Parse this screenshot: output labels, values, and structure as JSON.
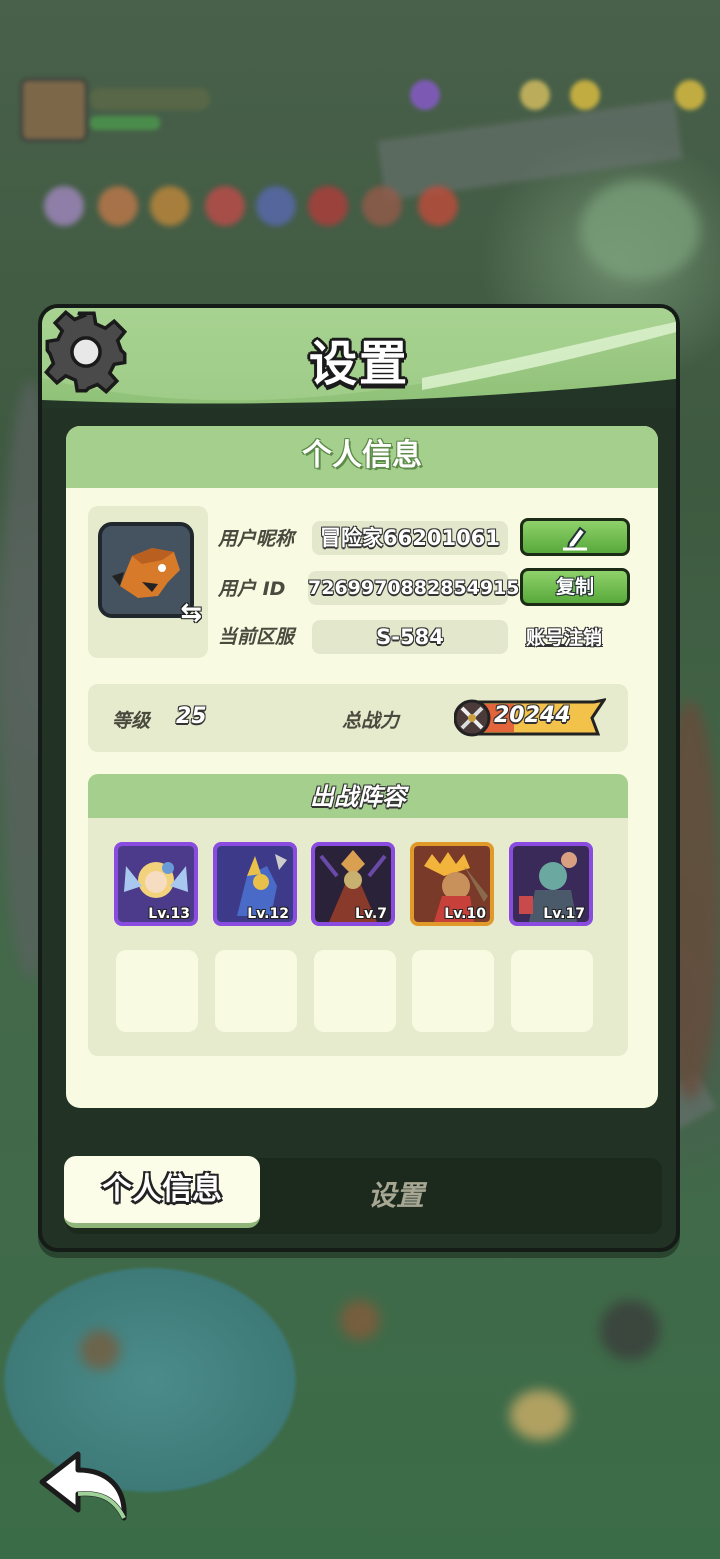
{
  "panel": {
    "title": "设置"
  },
  "card": {
    "header": "个人信息",
    "nickname_label": "用户昵称",
    "nickname_value": "冒险家66201061",
    "userid_label": "用户 ID",
    "userid_value": "7269970882854915",
    "userid_copy_button": "复制",
    "server_label": "当前区服",
    "server_value": "S-584",
    "delete_account_link": "账号注销",
    "level_label": "等级",
    "level_value": "25",
    "power_label": "总战力",
    "power_value": "20244"
  },
  "lineup": {
    "header": "出战阵容",
    "heroes": [
      {
        "level": "Lv.13",
        "rarity": "purple"
      },
      {
        "level": "Lv.12",
        "rarity": "purple"
      },
      {
        "level": "Lv.7",
        "rarity": "purple"
      },
      {
        "level": "Lv.10",
        "rarity": "gold"
      },
      {
        "level": "Lv.17",
        "rarity": "purple"
      }
    ]
  },
  "tabs": {
    "active": "个人信息",
    "other": "设置"
  },
  "icons": {
    "settings": "gear-icon",
    "edit": "pencil-icon",
    "swap": "swap-icon",
    "power": "crossed-swords-icon",
    "back": "back-arrow-icon"
  },
  "colors": {
    "header_green": "#a6d08f",
    "button_green": "#58a93b",
    "rare_purple": "#8a4be0",
    "legend_gold": "#e19a2a",
    "card_bg": "#f8fbe2"
  }
}
